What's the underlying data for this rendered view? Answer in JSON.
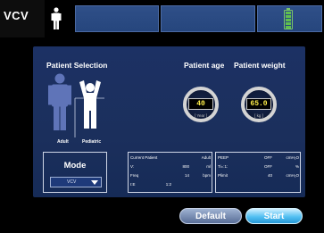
{
  "topbar": {
    "mode": "VCV",
    "colors": {
      "panel": "#2a4a82",
      "battery": "#5fc04c"
    },
    "icons": {
      "patient": "patient-icon",
      "battery": "battery-icon"
    }
  },
  "patient_selection": {
    "title": "Patient Selection",
    "adult_label": "Adult",
    "pediatric_label": "Pediatric",
    "selected": "Adult"
  },
  "patient_age": {
    "title": "Patient age",
    "value": "40",
    "unit": "[ Year ]"
  },
  "patient_weight": {
    "title": "Patient weight",
    "value": "65.0",
    "unit": "[ kg ]"
  },
  "mode": {
    "title": "Mode",
    "value": "VCV"
  },
  "summary_left": {
    "rows": [
      {
        "label": "Current Patient",
        "value": "Adult",
        "unit": ""
      },
      {
        "label": "V:",
        "value": "800",
        "unit": "ml"
      },
      {
        "label": "Freq",
        "value": "14",
        "unit": "bpm"
      },
      {
        "label": "I:E",
        "value": "1:2",
        "unit": ""
      }
    ]
  },
  "summary_right": {
    "rows": [
      {
        "label": "PEEP",
        "value": "OFF",
        "unit": "cmH₂O"
      },
      {
        "label": "Ti=:1:",
        "value": "OFF",
        "unit": "%"
      },
      {
        "label": "Plimit",
        "value": "40",
        "unit": "cmH₂O"
      }
    ]
  },
  "buttons": {
    "default": "Default",
    "start": "Start"
  }
}
